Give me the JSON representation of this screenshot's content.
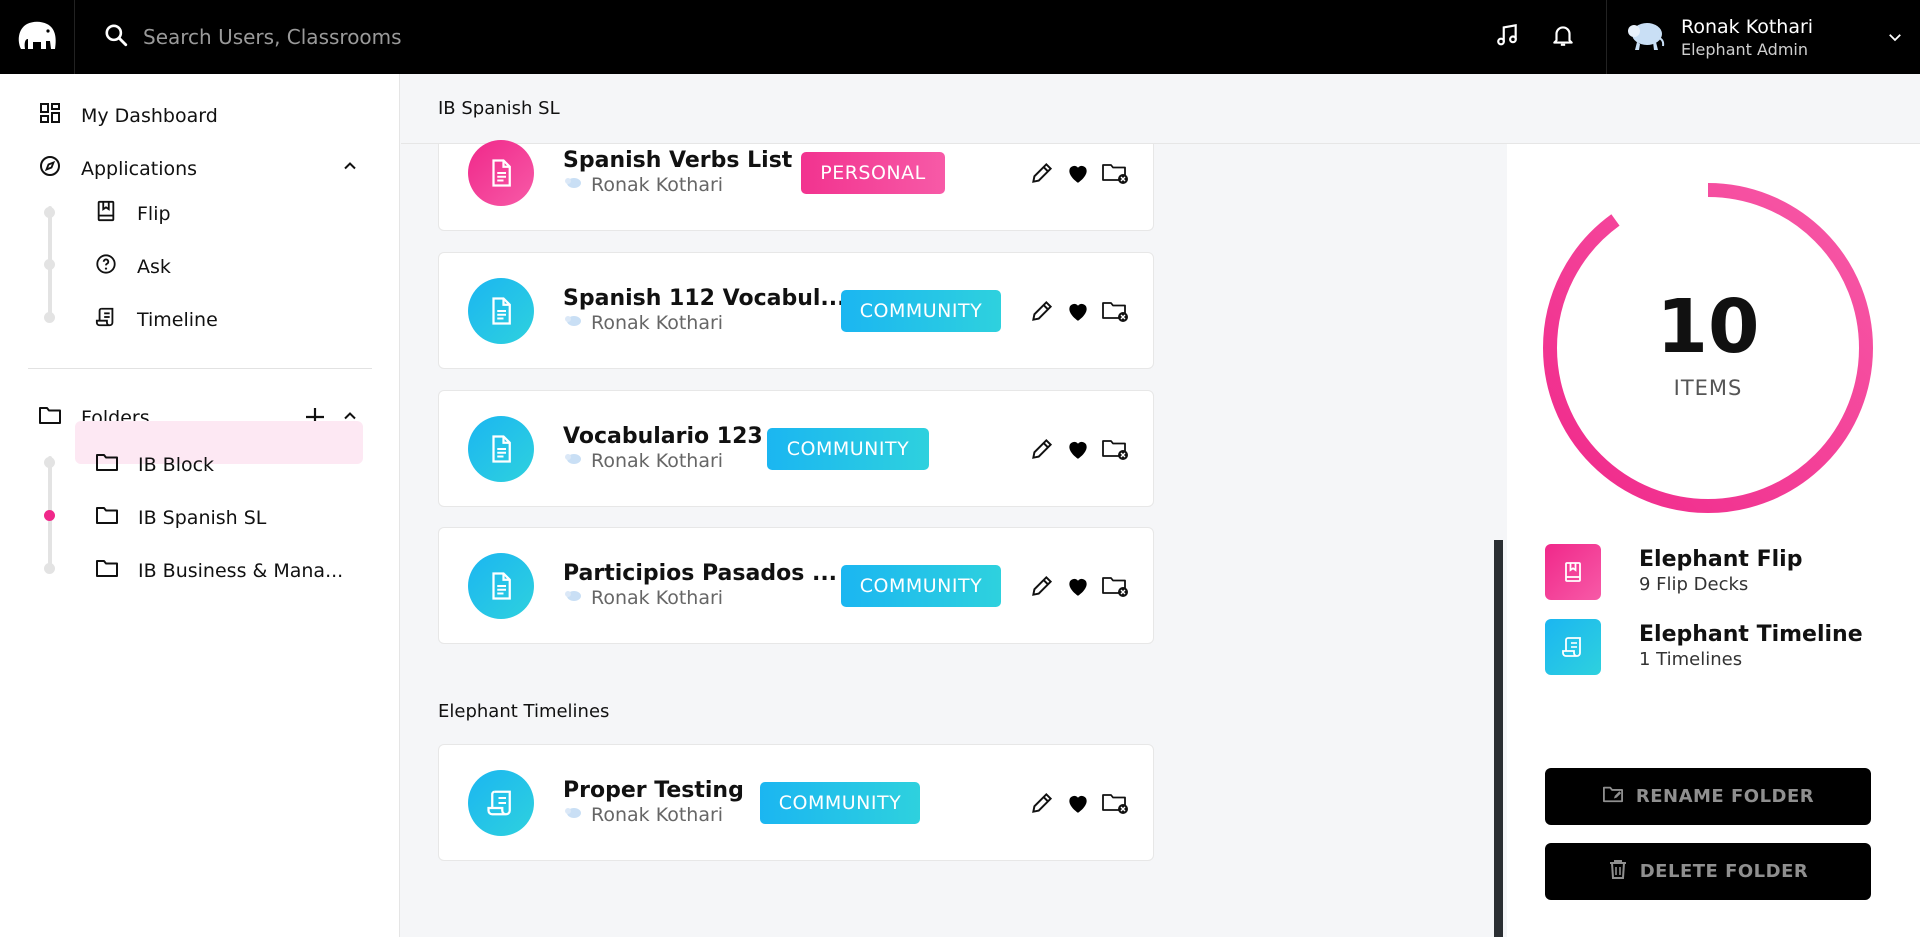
{
  "search": {
    "placeholder": "Search Users, Classrooms"
  },
  "user": {
    "name": "Ronak Kothari",
    "role": "Elephant Admin"
  },
  "sidebar": {
    "dashboard_label": "My Dashboard",
    "applications_label": "Applications",
    "apps": [
      {
        "label": "Flip"
      },
      {
        "label": "Ask"
      },
      {
        "label": "Timeline"
      }
    ],
    "folders_label": "Folders",
    "folders": [
      {
        "label": "IB Block"
      },
      {
        "label": "IB Spanish SL"
      },
      {
        "label": "IB Business & Mana..."
      }
    ]
  },
  "main": {
    "title": "IB Spanish SL",
    "decks": [
      {
        "title": "Spanish Verbs List",
        "author": "Ronak Kothari",
        "badge": "PERSONAL"
      },
      {
        "title": "Spanish 112 Vocabul...",
        "author": "Ronak Kothari",
        "badge": "COMMUNITY"
      },
      {
        "title": "Vocabulario 123",
        "author": "Ronak Kothari",
        "badge": "COMMUNITY"
      },
      {
        "title": "Participios Pasados ...",
        "author": "Ronak Kothari",
        "badge": "COMMUNITY"
      }
    ],
    "timelines_label": "Elephant Timelines",
    "timelines": [
      {
        "title": "Proper Testing",
        "author": "Ronak Kothari",
        "badge": "COMMUNITY"
      }
    ]
  },
  "summary": {
    "count": "10",
    "count_label": "ITEMS",
    "flip_title": "Elephant Flip",
    "flip_sub": "9 Flip Decks",
    "timeline_title": "Elephant Timeline",
    "timeline_sub": "1 Timelines",
    "rename_label": "RENAME FOLDER",
    "delete_label": "DELETE FOLDER",
    "flip_fraction": 0.9,
    "timeline_fraction": 0.1
  },
  "colors": {
    "pink": "#f0288a",
    "cyan": "#1bb6f1",
    "black": "#000000"
  }
}
